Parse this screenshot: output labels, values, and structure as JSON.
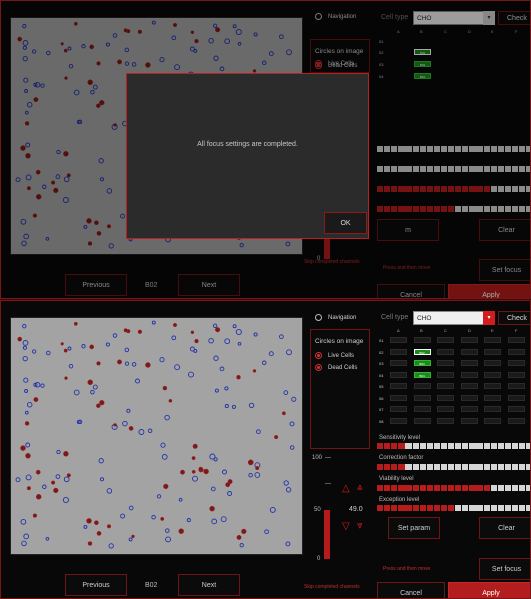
{
  "top_screen": {
    "navigation_label": "Navigation",
    "circles_title": "Circles on image",
    "live_cells": "Live Cells",
    "dead_cells": "Dead Cells",
    "cell_type_label": "Cell type",
    "cell_type_value": "CHO",
    "check_label": "Check",
    "col_headers": [
      "A",
      "B",
      "C",
      "D",
      "E",
      "F"
    ],
    "rows": [
      "01",
      "02",
      "03",
      "04"
    ],
    "wells": {
      "B02": "B02",
      "B03": "B03",
      "B04": "B04"
    },
    "dialog_message": "All focus settings are completed.",
    "ok_label": "OK",
    "param_label": "m",
    "clear_label": "Clear",
    "press_hint": "Press and then move",
    "set_focus_label": "Set focus",
    "cancel_label": "Cancel",
    "apply_label": "Apply",
    "skip_hint": "Skip completed channels",
    "previous_label": "Previous",
    "well_name": "B02",
    "next_label": "Next",
    "scale_zero": "0"
  },
  "bottom_screen": {
    "navigation_label": "Navigation",
    "circles_title": "Circles on image",
    "live_cells": "Live Cells",
    "dead_cells": "Dead Cells",
    "cell_type_label": "Cell type",
    "cell_type_value": "CHO",
    "check_label": "Check",
    "col_headers": [
      "A",
      "B",
      "C",
      "D",
      "E",
      "F"
    ],
    "rows": [
      "01",
      "02",
      "03",
      "04",
      "05",
      "06",
      "07",
      "08"
    ],
    "wells": {
      "B02": "B02",
      "B03": "B03",
      "B04": "B04"
    },
    "sensitivity_label": "Sensitivity level",
    "correction_label": "Correction factor",
    "viability_label": "Viability level",
    "exception_label": "Exception level",
    "scale_top": "100",
    "scale_mid": "50",
    "scale_zero": "0",
    "value_readout": "49.0",
    "set_param_label": "Set param",
    "clear_label": "Clear",
    "press_hint": "Press and then move",
    "set_focus_label": "Set focus",
    "cancel_label": "Cancel",
    "apply_label": "Apply",
    "skip_hint": "Skip completed channels",
    "previous_label": "Previous",
    "well_name": "B02",
    "next_label": "Next"
  },
  "levels": {
    "sensitivity_red_fraction": 0.17,
    "correction_red_fraction": 0.17,
    "viability_red_fraction": 0.72,
    "exception_red_fraction": 0.52,
    "threshold_fraction": 0.49
  },
  "colors": {
    "accent": "#b31d1d",
    "live": "#c62828",
    "dead": "#c62828",
    "well_green": "#1d8a1d"
  }
}
